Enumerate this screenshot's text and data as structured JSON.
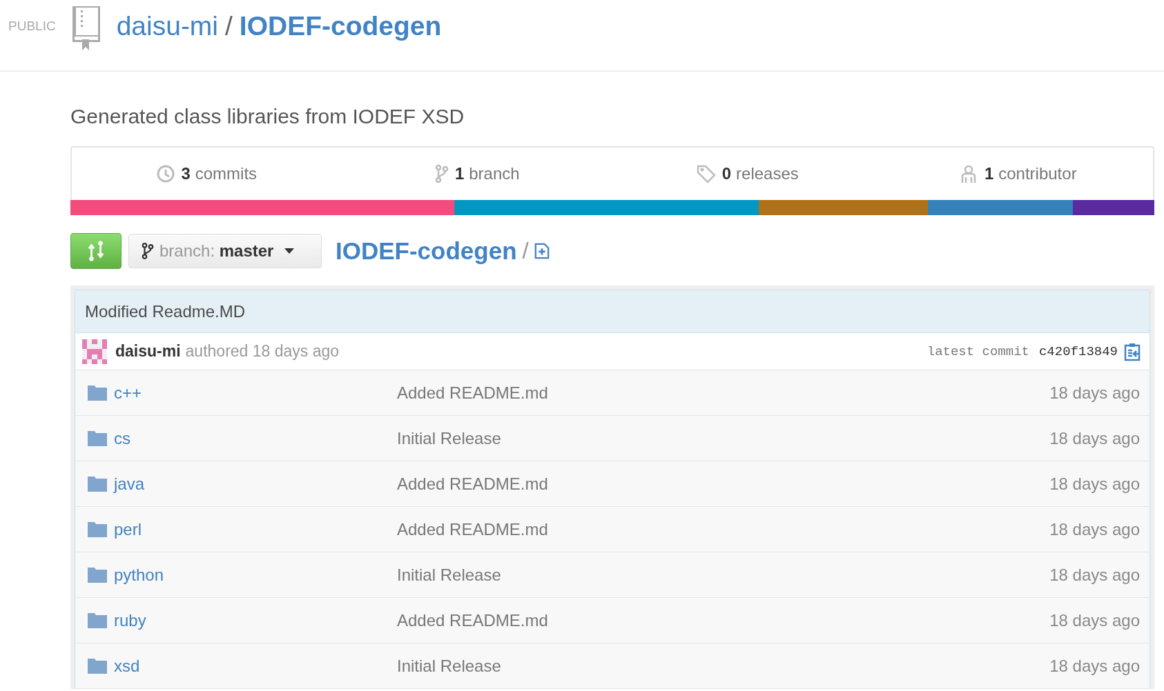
{
  "header": {
    "visibility": "PUBLIC",
    "owner": "daisu-mi",
    "separator": "/",
    "repo": "IODEF-codegen"
  },
  "description": "Generated class libraries from IODEF XSD",
  "stats": [
    {
      "kind": "commits",
      "count": "3",
      "label": "commits"
    },
    {
      "kind": "branches",
      "count": "1",
      "label": "branch"
    },
    {
      "kind": "releases",
      "count": "0",
      "label": "releases"
    },
    {
      "kind": "contributors",
      "count": "1",
      "label": "contributor"
    }
  ],
  "languages": [
    {
      "color": "#f34b7d"
    },
    {
      "color": "#0298c3"
    },
    {
      "color": "#b07219"
    },
    {
      "color": "#3581ba"
    },
    {
      "color": "#5a2aa0"
    }
  ],
  "toolbar": {
    "branch_label": "branch:",
    "branch": "master",
    "breadcrumb": "IODEF-codegen",
    "separator": "/"
  },
  "commit": {
    "message": "Modified Readme.MD",
    "author": "daisu-mi",
    "action": "authored 18 days ago",
    "label": "latest commit",
    "sha": "c420f13849"
  },
  "files": [
    {
      "kind": "folder",
      "name": "c++",
      "message": "Added README.md",
      "age": "18 days ago"
    },
    {
      "kind": "folder",
      "name": "cs",
      "message": "Initial Release",
      "age": "18 days ago"
    },
    {
      "kind": "folder",
      "name": "java",
      "message": "Added README.md",
      "age": "18 days ago"
    },
    {
      "kind": "folder",
      "name": "perl",
      "message": "Added README.md",
      "age": "18 days ago"
    },
    {
      "kind": "folder",
      "name": "python",
      "message": "Initial Release",
      "age": "18 days ago"
    },
    {
      "kind": "folder",
      "name": "ruby",
      "message": "Added README.md",
      "age": "18 days ago"
    },
    {
      "kind": "folder",
      "name": "xsd",
      "message": "Initial Release",
      "age": "18 days ago"
    }
  ]
}
